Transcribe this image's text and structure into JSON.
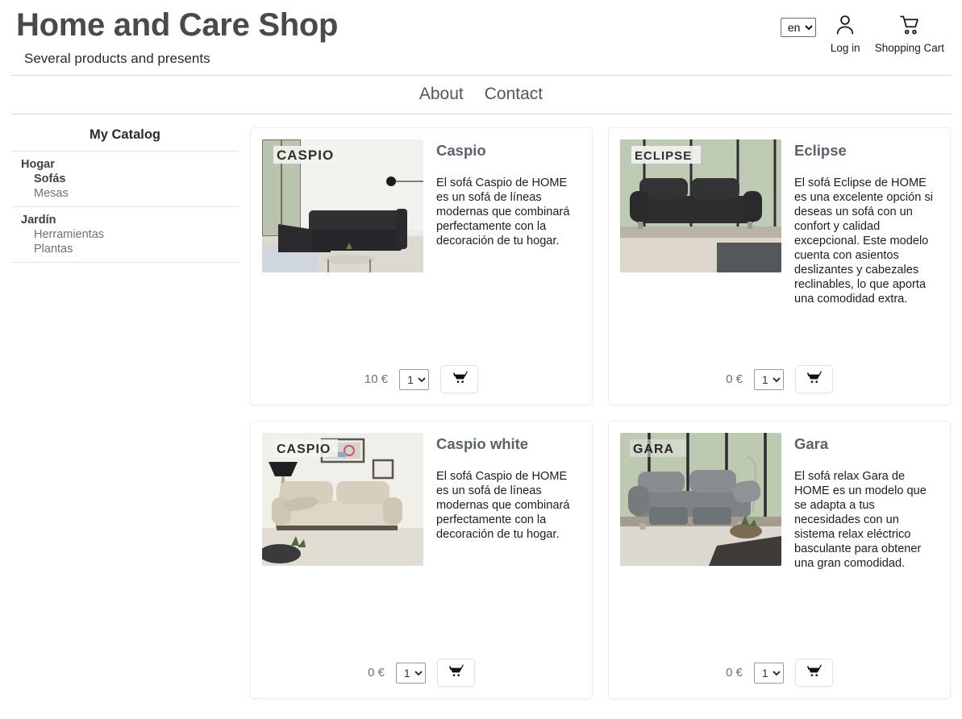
{
  "header": {
    "title": "Home and Care Shop",
    "subtitle": "Several products and presents",
    "language": {
      "value": "en",
      "options": [
        "en"
      ]
    },
    "login": {
      "label": "Log in",
      "icon": "user-icon"
    },
    "cart": {
      "label": "Shopping Cart",
      "icon": "shopping-cart-icon"
    }
  },
  "nav": {
    "items": [
      {
        "label": "About"
      },
      {
        "label": "Contact"
      }
    ]
  },
  "sidebar": {
    "title": "My Catalog",
    "groups": [
      {
        "label": "Hogar",
        "items": [
          {
            "label": "Sofás",
            "active": true
          },
          {
            "label": "Mesas",
            "active": false
          }
        ]
      },
      {
        "label": "Jardín",
        "items": [
          {
            "label": "Herramientas",
            "active": false
          },
          {
            "label": "Plantas",
            "active": false
          }
        ]
      }
    ]
  },
  "products": [
    {
      "name": "Caspio",
      "description": "El sofá Caspio de HOME es un sofá de líneas modernas que combinará perfectamente con la decoración de tu hogar.",
      "price": "10 €",
      "quantity": "1",
      "quantity_options": [
        "1"
      ],
      "image_badge": "CASPIO",
      "image_alt": "dark-grey-sectional-sofa",
      "add_to_cart_icon": "shopping-cart-icon"
    },
    {
      "name": "Eclipse",
      "description": "El sofá Eclipse de HOME es una excelente opción si deseas un sofá con un confort y calidad excepcional. Este modelo cuenta con asientos deslizantes y cabezales reclinables, lo que aporta una comodidad extra.",
      "price": "0 €",
      "quantity": "1",
      "quantity_options": [
        "1"
      ],
      "image_badge": "ECLIPSE",
      "image_alt": "black-two-seater-sofa",
      "add_to_cart_icon": "shopping-cart-icon"
    },
    {
      "name": "Caspio white",
      "description": "El sofá Caspio de HOME es un sofá de líneas modernas que combinará perfectamente con la decoración de tu hogar.",
      "price": "0 €",
      "quantity": "1",
      "quantity_options": [
        "1"
      ],
      "image_badge": "CASPIO",
      "image_alt": "beige-sofa-with-floor-lamp",
      "add_to_cart_icon": "shopping-cart-icon"
    },
    {
      "name": "Gara",
      "description": "El sofá relax Gara de HOME es un modelo que se adapta a tus necesidades con un sistema relax eléctrico basculante para obtener una gran comodidad.",
      "price": "0 €",
      "quantity": "1",
      "quantity_options": [
        "1"
      ],
      "image_badge": "GARA",
      "image_alt": "grey-recliner-sofa",
      "add_to_cart_icon": "shopping-cart-icon"
    }
  ],
  "colors": {
    "title": "#4a4a4a",
    "nav": "#4f5862",
    "card_title": "#5a636b",
    "price": "#6b7278",
    "border": "#eceded"
  }
}
